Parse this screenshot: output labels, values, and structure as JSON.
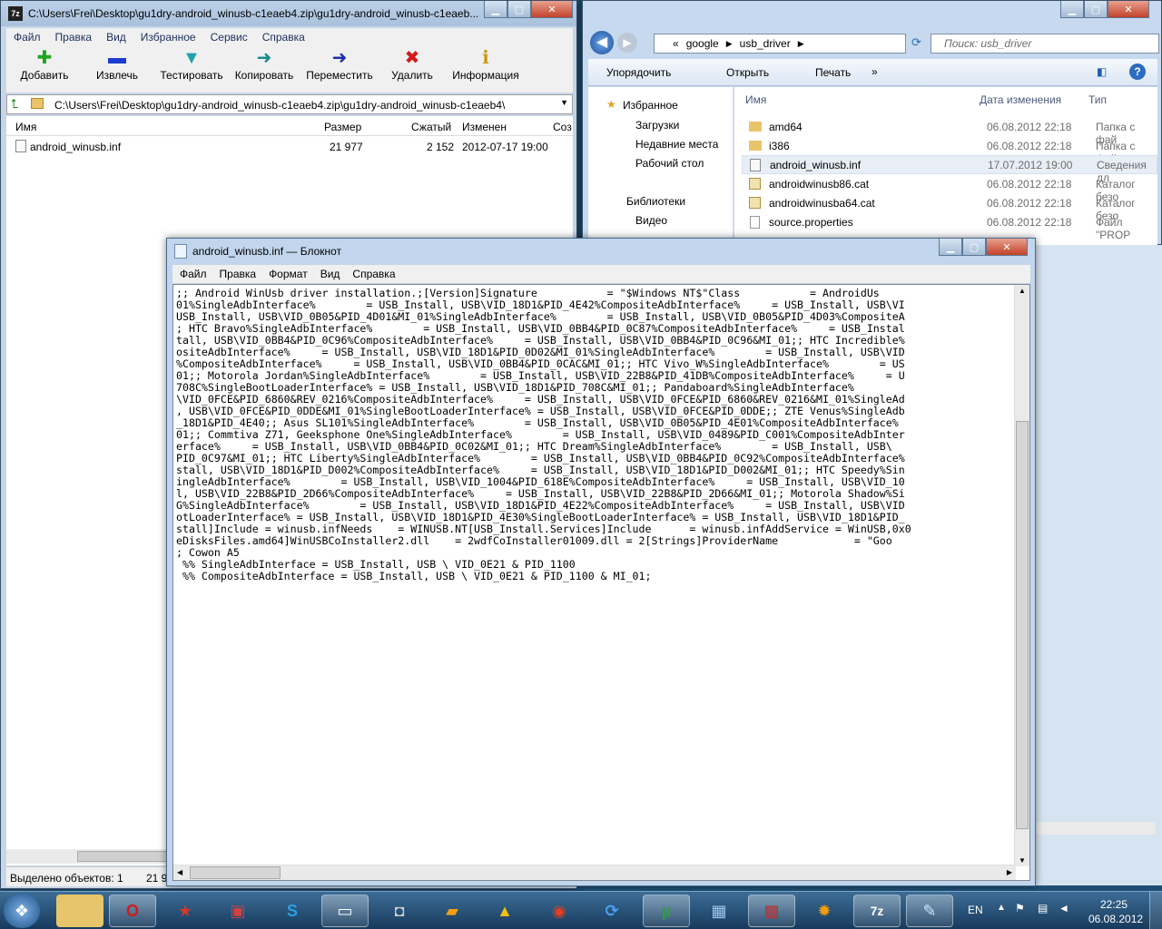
{
  "sevenzip": {
    "title": "C:\\Users\\Frei\\Desktop\\gu1dry-android_winusb-c1eaeb4.zip\\gu1dry-android_winusb-c1eaeb...",
    "menu": [
      "Файл",
      "Правка",
      "Вид",
      "Избранное",
      "Сервис",
      "Справка"
    ],
    "toolbar": {
      "add": "Добавить",
      "extract": "Извлечь",
      "test": "Тестировать",
      "copy": "Копировать",
      "move": "Переместить",
      "delete": "Удалить",
      "info": "Информация"
    },
    "address": "C:\\Users\\Frei\\Desktop\\gu1dry-android_winusb-c1eaeb4.zip\\gu1dry-android_winusb-c1eaeb4\\",
    "columns": {
      "name": "Имя",
      "size": "Размер",
      "packed": "Сжатый",
      "modified": "Изменен",
      "created": "Соз"
    },
    "file": {
      "name": "android_winusb.inf",
      "size": "21 977",
      "packed": "2 152",
      "modified": "2012-07-17 19:00"
    },
    "status": {
      "selected": "Выделено объектов: 1",
      "size": "21 9"
    }
  },
  "explorer": {
    "crumbs": [
      "«",
      "google",
      "usb_driver"
    ],
    "search_placeholder": "Поиск: usb_driver",
    "commands": {
      "organize": "Упорядочить",
      "open": "Открыть",
      "print": "Печать",
      "more": "»"
    },
    "sidebar": {
      "favorites": "Избранное",
      "downloads": "Загрузки",
      "recent": "Недавние места",
      "desktop": "Рабочий стол",
      "libraries": "Библиотеки",
      "video": "Видео"
    },
    "columns": {
      "name": "Имя",
      "date": "Дата изменения",
      "type": "Тип"
    },
    "files": [
      {
        "name": "amd64",
        "date": "06.08.2012 22:18",
        "type": "Папка с фай"
      },
      {
        "name": "i386",
        "date": "06.08.2012 22:18",
        "type": "Папка с фай"
      },
      {
        "name": "android_winusb.inf",
        "date": "17.07.2012 19:00",
        "type": "Сведения дл"
      },
      {
        "name": "androidwinusb86.cat",
        "date": "06.08.2012 22:18",
        "type": "Каталог безо"
      },
      {
        "name": "androidwinusba64.cat",
        "date": "06.08.2012 22:18",
        "type": "Каталог безо"
      },
      {
        "name": "source.properties",
        "date": "06.08.2012 22:18",
        "type": "Файл \"PROP"
      }
    ]
  },
  "notepad": {
    "title": "android_winusb.inf — Блокнот",
    "menu": [
      "Файл",
      "Правка",
      "Формат",
      "Вид",
      "Справка"
    ],
    "text": ";; Android WinUsb driver installation.;[Version]Signature           = \"$Windows NT$\"Class           = AndroidUs\n01%SingleAdbInterface%        = USB_Install, USB\\VID_18D1&PID_4E42%CompositeAdbInterface%     = USB_Install, USB\\VI\nUSB_Install, USB\\VID_0B05&PID_4D01&MI_01%SingleAdbInterface%        = USB_Install, USB\\VID_0B05&PID_4D03%CompositeA\n; HTC Bravo%SingleAdbInterface%        = USB_Install, USB\\VID_0BB4&PID_0C87%CompositeAdbInterface%     = USB_Instal\ntall, USB\\VID_0BB4&PID_0C96%CompositeAdbInterface%     = USB_Install, USB\\VID_0BB4&PID_0C96&MI_01;; HTC Incredible%\nositeAdbInterface%     = USB_Install, USB\\VID_18D1&PID_0D02&MI_01%SingleAdbInterface%        = USB_Install, USB\\VID\n%CompositeAdbInterface%     = USB_Install, USB\\VID_0BB4&PID_0CAC&MI_01;; HTC Vivo_W%SingleAdbInterface%        = US\n01;; Motorola Jordan%SingleAdbInterface%        = USB_Install, USB\\VID_22B8&PID_41DB%CompositeAdbInterface%     = U\n708C%SingleBootLoaderInterface% = USB_Install, USB\\VID_18D1&PID_708C&MI_01;; Pandaboard%SingleAdbInterface%        \n\\VID_0FCE&PID_6860&REV_0216%CompositeAdbInterface%     = USB_Install, USB\\VID_0FCE&PID_6860&REV_0216&MI_01%SingleAd\n, USB\\VID_0FCE&PID_0DDE&MI_01%SingleBootLoaderInterface% = USB_Install, USB\\VID_0FCE&PID_0DDE;; ZTE Venus%SingleAdb\n_18D1&PID_4E40;; Asus SL101%SingleAdbInterface%        = USB_Install, USB\\VID_0B05&PID_4E01%CompositeAdbInterface%\n01;; Commtiva Z71, Geeksphone One%SingleAdbInterface%        = USB_Install, USB\\VID_0489&PID_C001%CompositeAdbInter\nerface%     = USB_Install, USB\\VID_0BB4&PID_0C02&MI_01;; HTC Dream%SingleAdbInterface%        = USB_Install, USB\\\nPID_0C97&MI_01;; HTC Liberty%SingleAdbInterface%        = USB_Install, USB\\VID_0BB4&PID_0C92%CompositeAdbInterface%\nstall, USB\\VID_18D1&PID_D002%CompositeAdbInterface%     = USB_Install, USB\\VID_18D1&PID_D002&MI_01;; HTC Speedy%Sin\ningleAdbInterface%        = USB_Install, USB\\VID_1004&PID_618E%CompositeAdbInterface%     = USB_Install, USB\\VID_10\nl, USB\\VID_22B8&PID_2D66%CompositeAdbInterface%     = USB_Install, USB\\VID_22B8&PID_2D66&MI_01;; Motorola Shadow%Si\nG%SingleAdbInterface%        = USB_Install, USB\\VID_18D1&PID_4E22%CompositeAdbInterface%     = USB_Install, USB\\VID\notLoaderInterface% = USB_Install, USB\\VID_18D1&PID_4E30%SingleBootLoaderInterface% = USB_Install, USB\\VID_18D1&PID_\nstall]Include = winusb.infNeeds    = WINUSB.NT[USB_Install.Services]Include      = winusb.infAddService = WinUSB,0x0\neDisksFiles.amd64]WinUSBCoInstaller2.dll    = 2wdfCoInstaller01009.dll = 2[Strings]ProviderName            = \"Goo\n; Cowon A5\n %% SingleAdbInterface = USB_Install, USB \\ VID_0E21 & PID_1100\n %% CompositeAdbInterface = USB_Install, USB \\ VID_0E21 & PID_1100 & MI_01;"
  },
  "taskbar": {
    "lang": "EN",
    "time": "22:25",
    "date": "06.08.2012"
  }
}
